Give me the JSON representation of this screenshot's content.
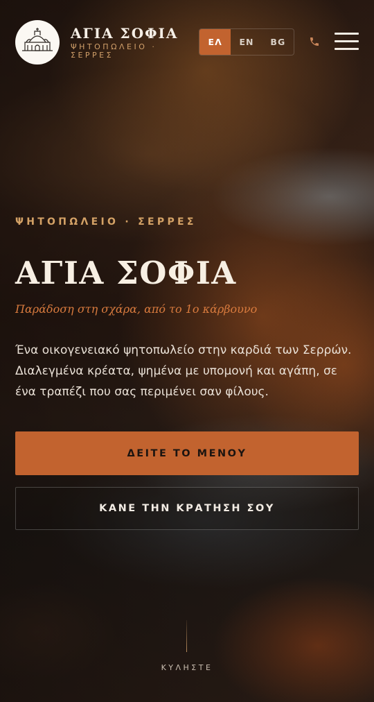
{
  "header": {
    "brand_name": "ΑΓΙΑ ΣΟΦΙΑ",
    "brand_subtitle": "ΨΗΤΟΠΩΛΕΙΟ · ΣΕΡΡΕΣ",
    "languages": [
      {
        "label": "ΕΛ",
        "active": true
      },
      {
        "label": "EN",
        "active": false
      },
      {
        "label": "BG",
        "active": false
      }
    ],
    "phone_icon": "phone-icon",
    "menu_icon": "hamburger-menu-icon"
  },
  "hero": {
    "eyebrow": "ΨΗΤΟΠΩΛΕΙΟ · ΣΕΡΡΕΣ",
    "title": "ΑΓΙΑ ΣΟΦΙΑ",
    "tagline": "Παράδοση στη σχάρα, από το 1ο κάρβουνο",
    "description": "Ένα οικογενειακό ψητοπωλείο στην καρδιά των Σερρών. Διαλεγμένα κρέατα, ψημένα με υπομονή και αγάπη, σε ένα τραπέζι που σας περιμένει σαν φίλους.",
    "primary_button": "ΔΕΙΤΕ ΤΟ ΜΕΝΟΥ",
    "secondary_button": "ΚΑΝΕ ΤΗΝ ΚΡΑΤΗΣΗ ΣΟΥ",
    "scroll_label": "ΚΥΛΗΣΤΕ"
  },
  "colors": {
    "accent": "#c2632f",
    "gold": "#d4a266",
    "tagline": "#d97b3e",
    "text": "#f3ece4"
  }
}
